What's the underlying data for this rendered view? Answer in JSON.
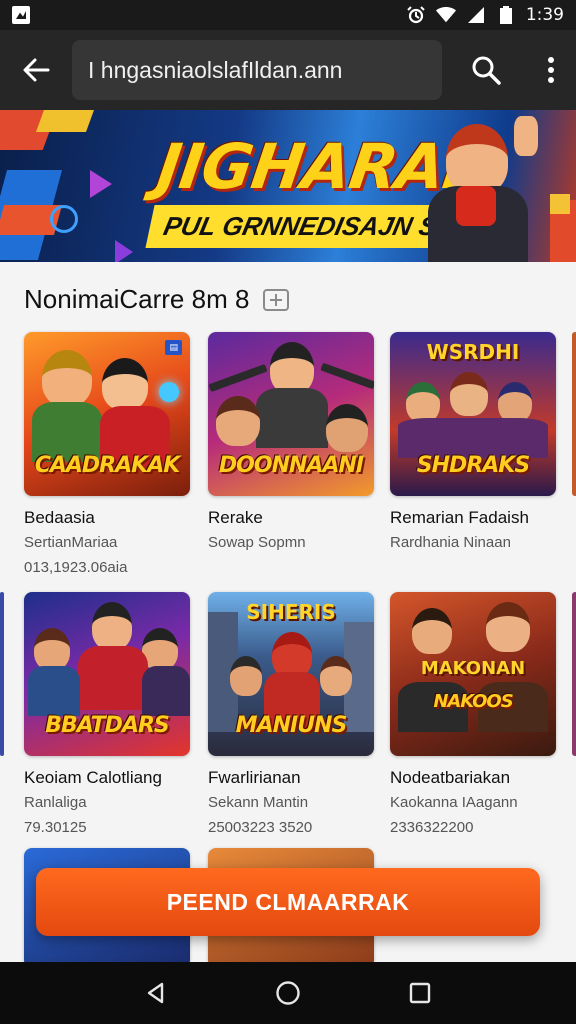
{
  "status_bar": {
    "time": "1:39",
    "icons": [
      "image-icon",
      "alarm-icon",
      "wifi-icon",
      "signal-icon",
      "battery-icon"
    ]
  },
  "app_bar": {
    "back_icon": "arrow-left-icon",
    "search_text": "I hngasniaolslafIldan.ann",
    "search_icon": "search-icon",
    "more_icon": "more-vert-icon"
  },
  "banner": {
    "title": "JIGHARAI",
    "subtitle": "PUL GRNNEDISAJN SAHT"
  },
  "section": {
    "title": "NonimaiCarre 8m 8",
    "icon": "filter-box-icon"
  },
  "cards": [
    {
      "name": "Bedaasia",
      "sub": "SertianMariaa",
      "num": "013,1923.06aia",
      "art_title": "CAADRAKAK",
      "art_top": ""
    },
    {
      "name": "Rerake",
      "sub": "Sowap Sopmn",
      "num": "",
      "art_title": "DOONNAANI",
      "art_top": ""
    },
    {
      "name": "Remarian Fadaish",
      "sub": "Rardhania Ninaan",
      "num": "",
      "art_title": "SHDRAKS",
      "art_top": "WSRDHI"
    },
    {
      "name": "Keoiam Calotliang",
      "sub": "Ranlaliga",
      "num": "79.30125",
      "art_title": "BBATDARS",
      "art_top": ""
    },
    {
      "name": "Fwarlirianan",
      "sub": "Sekann Mantin",
      "num": "25003223 3520",
      "art_title": "MANIUNS",
      "art_top": "SIHERIS"
    },
    {
      "name": "Nodeatbariakan",
      "sub": "Kaokanna IAagann",
      "num": "2336322200",
      "art_title": "NAKOOS",
      "art_top": "MAKONAN"
    }
  ],
  "cta": {
    "label": "PEEND CLMAARRAK"
  },
  "nav_bar": {
    "icons": [
      "back-triangle-icon",
      "home-circle-icon",
      "recents-square-icon"
    ]
  },
  "colors": {
    "accent": "#e8510f",
    "app_bar": "#262626",
    "status_bar": "#1a1a1a"
  }
}
